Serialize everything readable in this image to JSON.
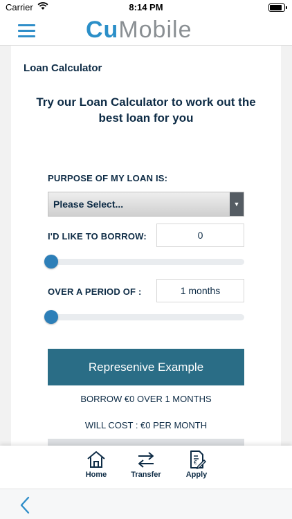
{
  "status_bar": {
    "carrier": "Carrier",
    "time": "8:14 PM"
  },
  "header": {
    "logo_part1": "Cu",
    "logo_part2": "Mobile"
  },
  "page": {
    "title": "Loan Calculator",
    "headline": "Try our Loan Calculator to work out the best loan for you"
  },
  "form": {
    "purpose_label": "PURPOSE OF MY LOAN IS:",
    "purpose_value": "Please Select...",
    "borrow_label": "I'D LIKE TO BORROW:",
    "borrow_value": "0",
    "borrow_slider_fraction": 0,
    "period_label": "OVER A PERIOD OF :",
    "period_value": "1 months",
    "period_slider_fraction": 0
  },
  "example": {
    "button_label": "Represenive Example",
    "borrow_line": "BORROW €0 OVER 1 MONTHS",
    "cost_line": "WILL COST : €0 PER MONTH"
  },
  "tabbar": {
    "items": [
      {
        "label": "Home",
        "icon": "home-icon"
      },
      {
        "label": "Transfer",
        "icon": "transfer-icon"
      },
      {
        "label": "Apply",
        "icon": "apply-icon"
      }
    ]
  },
  "colors": {
    "brand_blue": "#2b8fc8",
    "button_teal": "#2a6d86",
    "text_navy": "#0d2b45"
  }
}
